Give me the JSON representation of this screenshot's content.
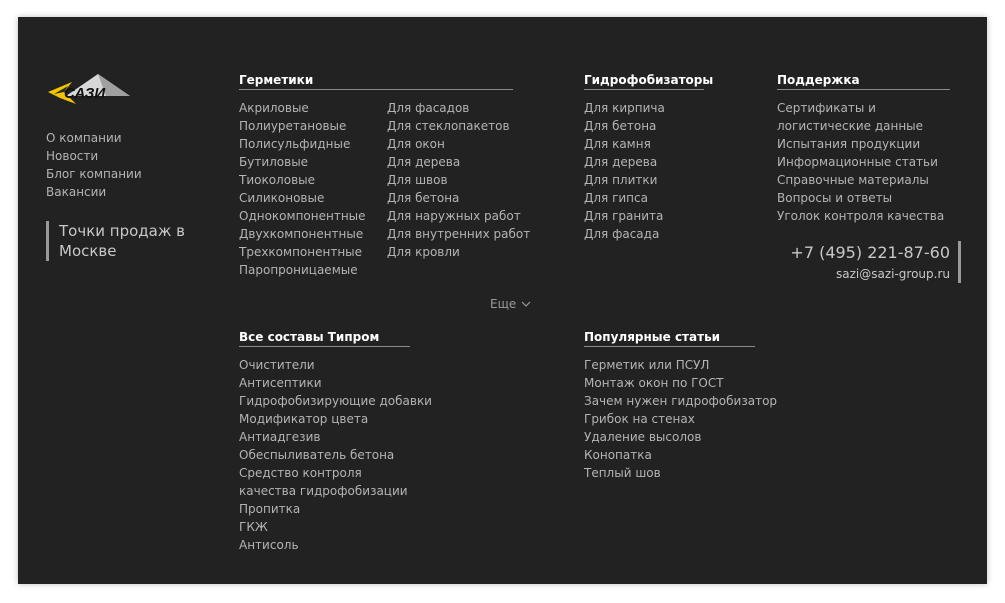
{
  "logo": {
    "text": "САЗИ"
  },
  "about_menu": [
    "О компании",
    "Новости",
    "Блог компании",
    "Вакансии"
  ],
  "stores_link": "Точки продаж в Москве",
  "sealants": {
    "title": "Герметики",
    "left": [
      "Акриловые",
      "Полиуретановые",
      "Полисульфидные",
      "Бутиловые",
      "Тиоколовые",
      "Силиконовые",
      "Однокомпонентные",
      "Двухкомпонентные",
      "Трехкомпонентные",
      "Паропроницаемые"
    ],
    "right": [
      "Для фасадов",
      "Для стеклопакетов",
      "Для окон",
      "Для дерева",
      "Для швов",
      "Для бетона",
      "Для наружных работ",
      "Для внутренних работ",
      "Для кровли"
    ]
  },
  "hydrophobizers": {
    "title": "Гидрофобизаторы",
    "items": [
      "Для кирпича",
      "Для бетона",
      "Для камня",
      "Для дерева",
      "Для плитки",
      "Для гипса",
      "Для гранита",
      "Для фасада"
    ]
  },
  "support": {
    "title": "Поддержка",
    "items": [
      "Сертификаты и логистические данные",
      "Испытания продукции",
      "Информационные статьи",
      "Справочные материалы",
      "Вопросы и ответы",
      "Уголок контроля качества"
    ]
  },
  "more": {
    "label": "Еще",
    "icon": "chevron-down-icon"
  },
  "contacts": {
    "phone": "+7 (495) 221-87-60",
    "email": "sazi@sazi-group.ru"
  },
  "tiprom": {
    "title": "Все составы Типром",
    "items": [
      "Очистители",
      "Антисептики",
      "Гидрофобизирующие добавки",
      "Модификатор цвета",
      "Антиадгезив",
      "Обеспыливатель бетона",
      "Средство контроля качества гидрофобизации",
      "Пропитка",
      "ГКЖ",
      "Антисоль"
    ]
  },
  "articles": {
    "title": "Популярные статьи",
    "items": [
      "Герметик или ПСУЛ",
      "Монтаж окон по ГОСТ",
      "Зачем нужен гидрофобизатор",
      "Грибок на стенах",
      "Удаление высолов",
      "Конопатка",
      "Теплый шов"
    ]
  },
  "colors": {
    "background": "#222222",
    "text": "#b4b4b4",
    "heading": "#ffffff",
    "logo_yellow": "#f2c400"
  }
}
